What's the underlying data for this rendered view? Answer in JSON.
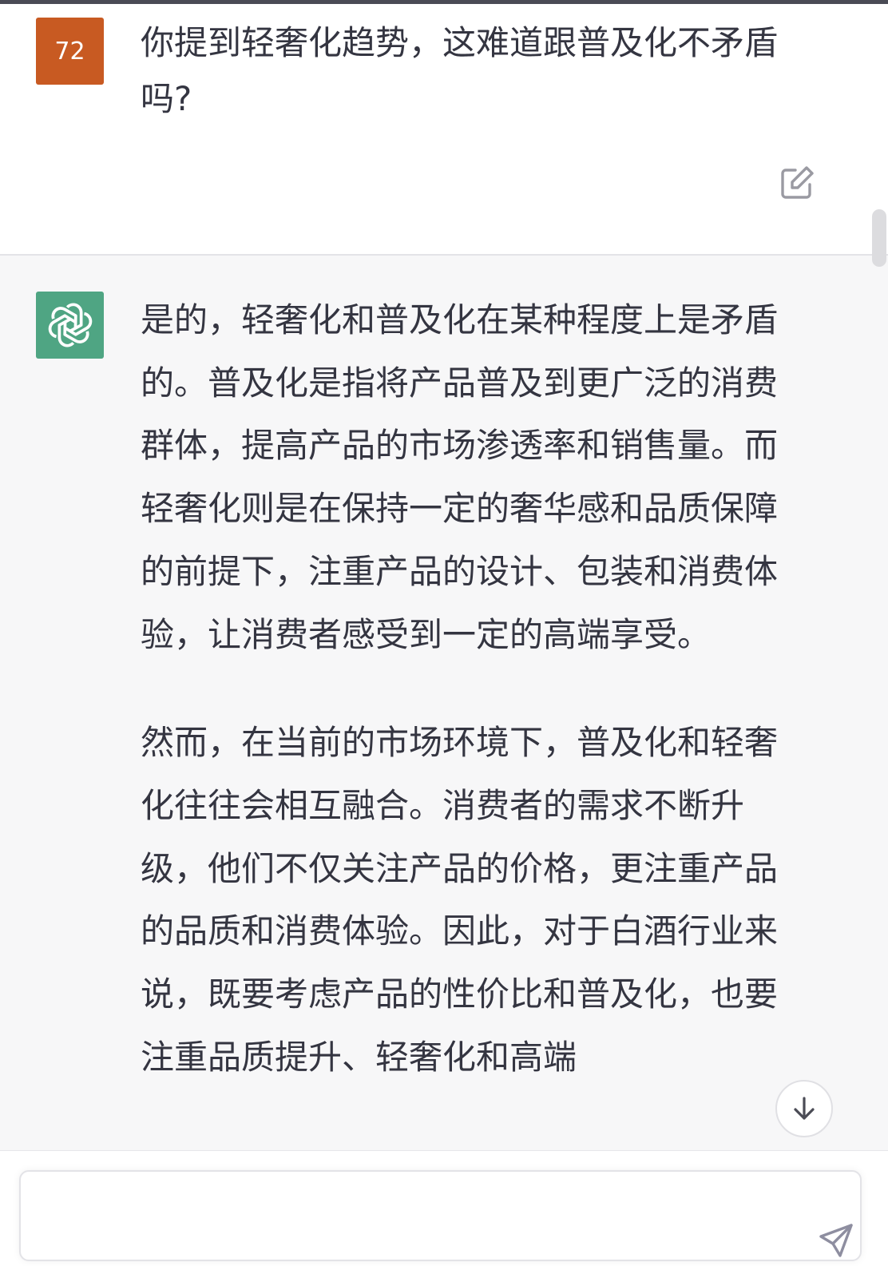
{
  "colors": {
    "user_avatar_bg": "#c85a22",
    "assistant_avatar_bg": "#4fa583",
    "assistant_bg": "#f7f7f8",
    "text": "#343541"
  },
  "user_message": {
    "avatar_label": "72",
    "text": "你提到轻奢化趋势，这难道跟普及化不矛盾吗?",
    "edit_icon": "edit-icon"
  },
  "assistant_message": {
    "avatar_icon": "openai-logo-icon",
    "paragraphs": [
      "是的，轻奢化和普及化在某种程度上是矛盾的。普及化是指将产品普及到更广泛的消费群体，提高产品的市场渗透率和销售量。而轻奢化则是在保持一定的奢华感和品质保障的前提下，注重产品的设计、包装和消费体验，让消费者感受到一定的高端享受。",
      "然而，在当前的市场环境下，普及化和轻奢化往往会相互融合。消费者的需求不断升级，他们不仅关注产品的价格，更注重产品的品质和消费体验。因此，对于白酒行业来说，既要考虑产品的性价比和普及化，也要注重品质提升、轻奢化和高端"
    ]
  },
  "controls": {
    "scroll_down_icon": "arrow-down-icon",
    "send_icon": "send-icon",
    "input_value": ""
  }
}
